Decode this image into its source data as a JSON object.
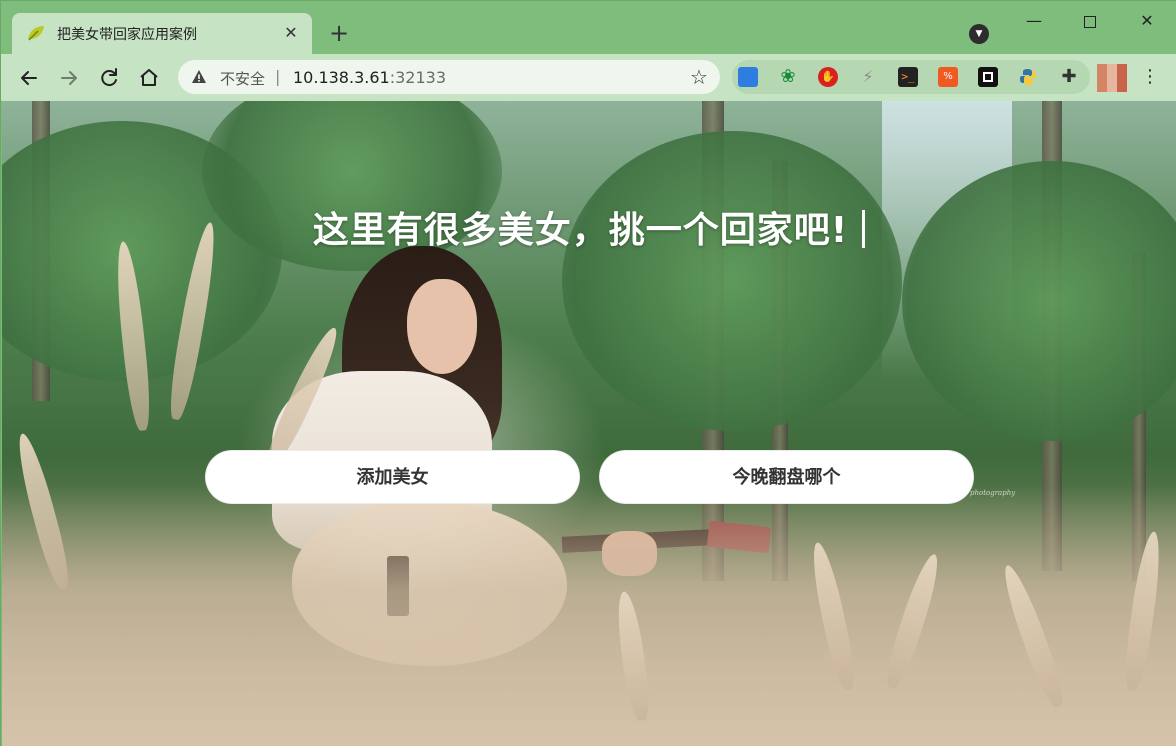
{
  "browser": {
    "tab": {
      "title": "把美女带回家应用案例"
    },
    "address": {
      "security_label": "不安全",
      "separator": "|",
      "host": "10.138.3.61",
      "port": ":32133"
    }
  },
  "page": {
    "headline": "这里有很多美女，挑一个回家吧!",
    "buttons": {
      "add_label": "添加美女",
      "pick_label": "今晚翻盘哪个"
    },
    "watermark": "photography"
  },
  "colors": {
    "chrome_frame": "#7fbd7c",
    "chrome_toolbar": "#c6e3c4",
    "button_bg": "#ffffff",
    "headline": "#ffffff"
  }
}
